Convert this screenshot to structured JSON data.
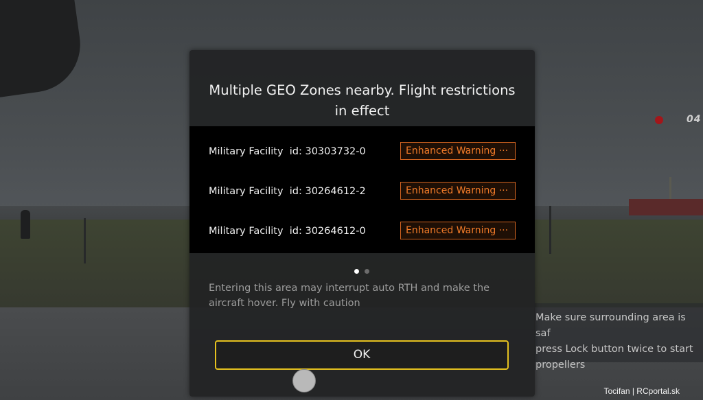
{
  "hud": {
    "record_time": "04",
    "side_hint": "Make sure surrounding area is saf\npress Lock button twice to start\npropellers"
  },
  "dialog": {
    "title": "Multiple GEO Zones nearby. Flight restrictions in effect",
    "zones": [
      {
        "name": "Military Facility  id: 30303732-0",
        "level": "Enhanced Warning ···"
      },
      {
        "name": "Military Facility  id: 30264612-2",
        "level": "Enhanced Warning ···"
      },
      {
        "name": "Military Facility  id: 30264612-0",
        "level": "Enhanced Warning ···"
      }
    ],
    "page_current": 1,
    "page_total": 2,
    "message": "Entering this area may interrupt auto RTH and make the aircraft hover. Fly with caution",
    "ok_label": "OK"
  },
  "watermark": "Tocifan | RCportal.sk",
  "colors": {
    "warning_orange": "#f07a28",
    "ok_border": "#e6c21f",
    "record_red": "#a3161a"
  }
}
